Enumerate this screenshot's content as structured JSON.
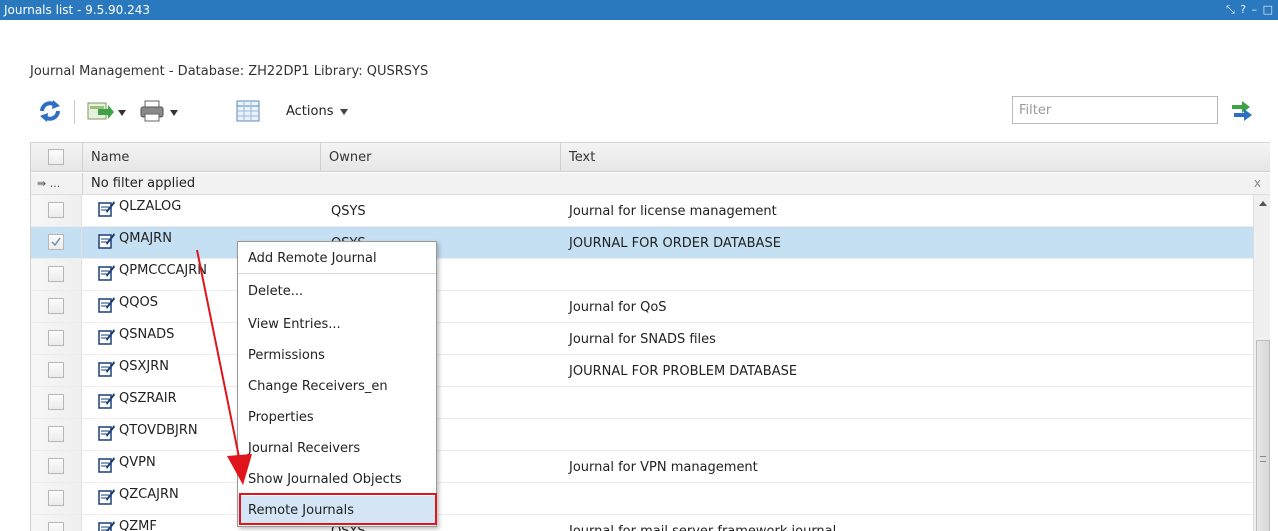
{
  "window": {
    "title": "Journals list - 9.5.90.243",
    "controls": "⤡ ? – □"
  },
  "subtitle": "Journal Management - Database: ZH22DP1 Library: QUSRSYS",
  "toolbar": {
    "actions_label": "Actions",
    "filter_placeholder": "Filter"
  },
  "table": {
    "columns": [
      "Name",
      "Owner",
      "Text"
    ],
    "filter_button": "⇛ ...",
    "filter_status": "No filter applied",
    "filter_clear": "x",
    "rows": [
      {
        "name": "QLZALOG",
        "owner": "QSYS",
        "text": "Journal for license management",
        "selected": false
      },
      {
        "name": "QMAJRN",
        "owner": "QSYS",
        "text": "JOURNAL FOR ORDER DATABASE",
        "selected": true
      },
      {
        "name": "QPMCCCAJRN",
        "owner": "",
        "text": "",
        "selected": false
      },
      {
        "name": "QQOS",
        "owner": "",
        "text": "Journal for QoS",
        "selected": false
      },
      {
        "name": "QSNADS",
        "owner": "",
        "text": "Journal for SNADS files",
        "selected": false
      },
      {
        "name": "QSXJRN",
        "owner": "",
        "text": "JOURNAL FOR PROBLEM DATABASE",
        "selected": false
      },
      {
        "name": "QSZRAIR",
        "owner": "",
        "text": "",
        "selected": false
      },
      {
        "name": "QTOVDBJRN",
        "owner": "",
        "text": "",
        "selected": false
      },
      {
        "name": "QVPN",
        "owner": "",
        "text": "Journal for VPN management",
        "selected": false
      },
      {
        "name": "QZCAJRN",
        "owner": "",
        "text": "",
        "selected": false
      },
      {
        "name": "QZMF",
        "owner": "QSYS",
        "text": "Journal for mail server framework journal..",
        "selected": false
      }
    ]
  },
  "context_menu": {
    "items": [
      "Add Remote Journal",
      "Delete...",
      "View Entries...",
      "Permissions",
      "Change Receivers_en",
      "Properties",
      "Journal Receivers",
      "Show Journaled Objects",
      "Remote Journals"
    ],
    "highlighted": "Remote Journals"
  },
  "colors": {
    "titlebar": "#2a78bd",
    "selection": "#c5dff3",
    "annotation": "#e0151b"
  },
  "icons": [
    "refresh-icon",
    "export-icon",
    "print-icon",
    "columns-icon",
    "go-icon",
    "journal-icon"
  ]
}
